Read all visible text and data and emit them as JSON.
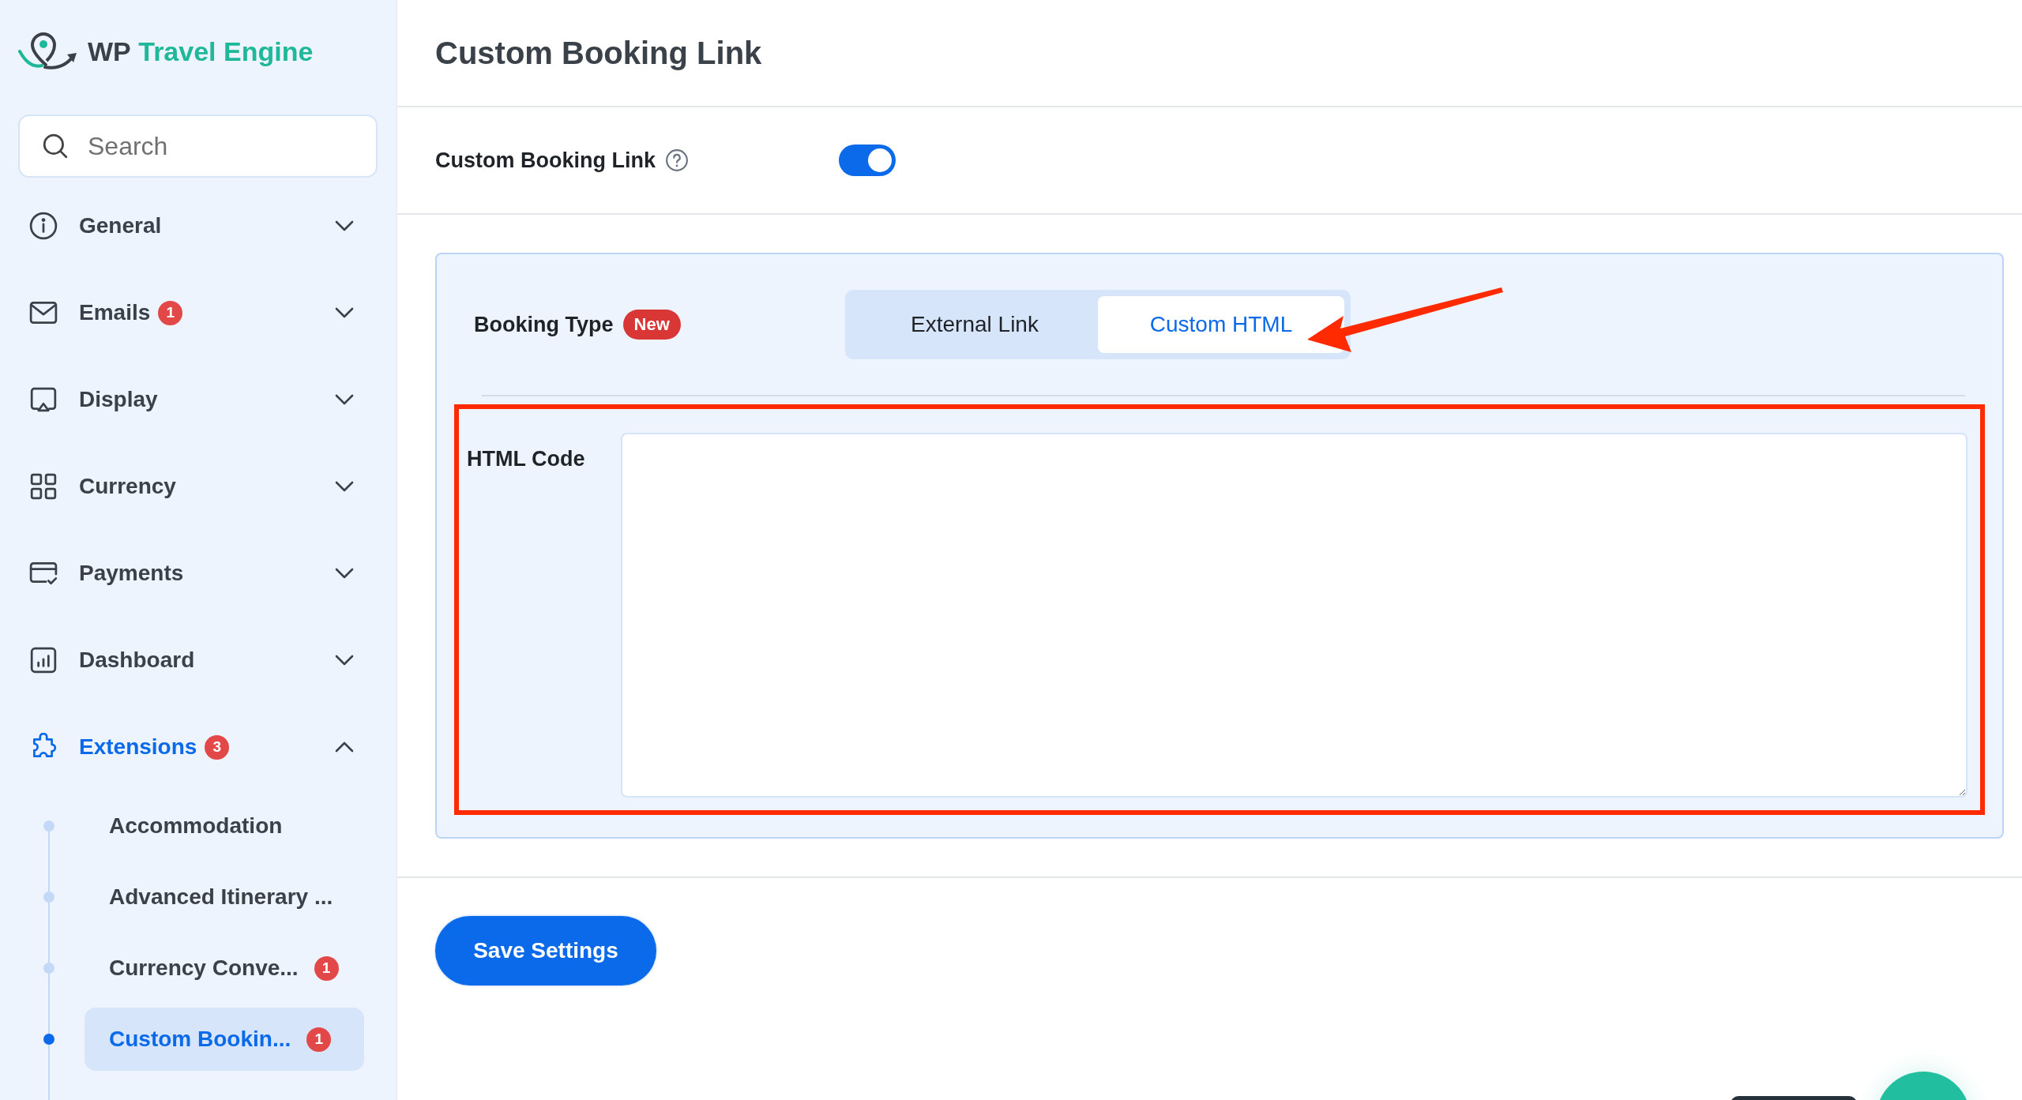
{
  "sidebar": {
    "logo": {
      "prefix": "WP",
      "name": "Travel Engine"
    },
    "search": {
      "placeholder": "Search"
    },
    "items": [
      {
        "label": "General",
        "expanded": false,
        "selected": false
      },
      {
        "label": "Emails",
        "badge": "1",
        "expanded": false,
        "selected": false
      },
      {
        "label": "Display",
        "expanded": false,
        "selected": false
      },
      {
        "label": "Currency",
        "expanded": false,
        "selected": false
      },
      {
        "label": "Payments",
        "expanded": false,
        "selected": false
      },
      {
        "label": "Dashboard",
        "expanded": false,
        "selected": false
      },
      {
        "label": "Extensions",
        "badge": "3",
        "expanded": true,
        "selected": true,
        "children": [
          {
            "label": "Accommodation",
            "selected": false
          },
          {
            "label": "Advanced Itinerary ...",
            "selected": false
          },
          {
            "label": "Currency Conve...",
            "badge": "1",
            "selected": false
          },
          {
            "label": "Custom Bookin...",
            "badge": "1",
            "selected": true
          }
        ]
      }
    ]
  },
  "main": {
    "title": "Custom Booking Link",
    "toggle": {
      "label": "Custom Booking Link",
      "on": true
    },
    "booking_type": {
      "label": "Booking Type",
      "badge": "New",
      "options": [
        {
          "label": "External Link",
          "selected": false
        },
        {
          "label": "Custom HTML",
          "selected": true
        }
      ]
    },
    "html_code": {
      "label": "HTML Code"
    },
    "save_button": "Save Settings"
  }
}
